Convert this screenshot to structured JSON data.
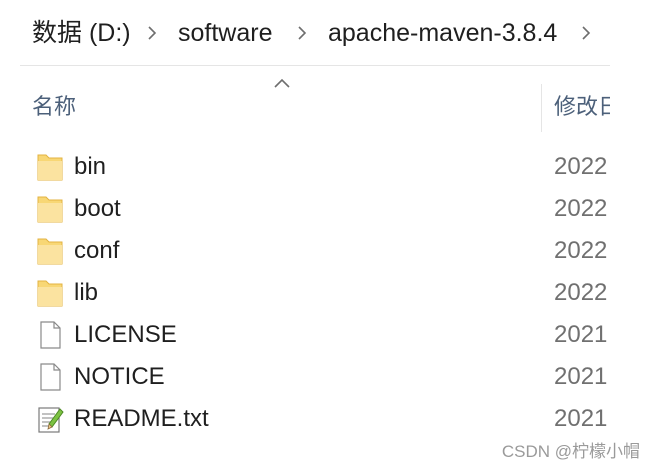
{
  "breadcrumb": {
    "items": [
      "数据 (D:)",
      "software",
      "apache-maven-3.8.4"
    ]
  },
  "columns": {
    "name": "名称",
    "date": "修改日"
  },
  "files": [
    {
      "name": "bin",
      "date": "2022",
      "icon": "folder-icon"
    },
    {
      "name": "boot",
      "date": "2022",
      "icon": "folder-icon"
    },
    {
      "name": "conf",
      "date": "2022",
      "icon": "folder-icon"
    },
    {
      "name": "lib",
      "date": "2022",
      "icon": "folder-icon"
    },
    {
      "name": "LICENSE",
      "date": "2021",
      "icon": "file-icon"
    },
    {
      "name": "NOTICE",
      "date": "2021",
      "icon": "file-icon"
    },
    {
      "name": "README.txt",
      "date": "2021",
      "icon": "text-file-icon"
    }
  ],
  "watermark": "CSDN @柠檬小帽",
  "colors": {
    "folder": "#f8d775",
    "header_text": "#4c607a",
    "date_text": "#707070"
  }
}
